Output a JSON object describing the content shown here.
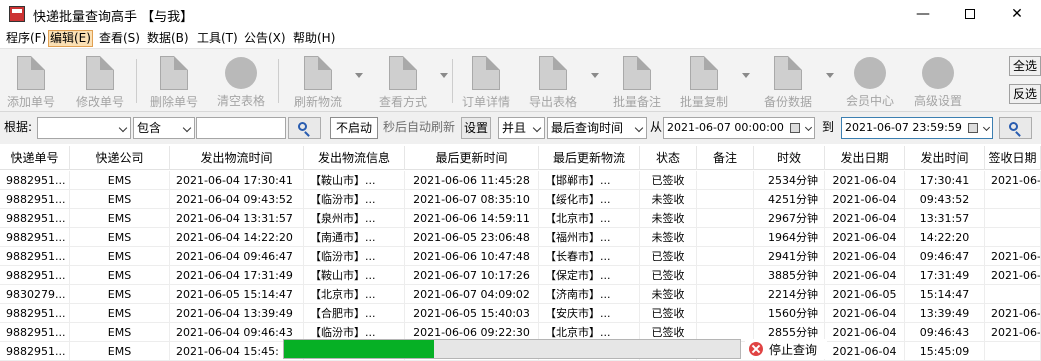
{
  "window": {
    "title": "快递批量查询高手 【与我】",
    "minimize": "—",
    "close": "✕"
  },
  "menu": [
    "程序(F)",
    "编辑(E)",
    "查看(S)",
    "数据(B)",
    "工具(T)",
    "公告(X)",
    "帮助(H)"
  ],
  "toolbar": {
    "add": "添加单号",
    "edit": "修改单号",
    "delete": "删除单号",
    "clear": "清空表格",
    "refresh": "刷新物流",
    "view_mode": "查看方式",
    "details": "订单详情",
    "export": "导出表格",
    "batch_note": "批量备注",
    "batch_copy": "批量复制",
    "backup": "备份数据",
    "member": "会员中心",
    "advanced": "高级设置",
    "select_all": "全选",
    "invert": "反选"
  },
  "filter": {
    "by_label": "根据:",
    "by_value": "",
    "match_value": "包含",
    "keyword": "",
    "auto_button": "不启动",
    "auto_label": "秒后自动刷新",
    "settings_button": "设置",
    "logic_value": "并且",
    "time_field_value": "最后查询时间",
    "from_label": "从",
    "from_value": "2021-06-07 00:00:00",
    "to_label": "到",
    "to_value": "2021-06-07 23:59:59"
  },
  "table": {
    "columns": [
      "快递单号",
      "快递公司",
      "发出物流时间",
      "发出物流信息",
      "最后更新时间",
      "最后更新物流",
      "状态",
      "备注",
      "时效",
      "发出日期",
      "发出时间",
      "签收日期"
    ],
    "rows": [
      [
        "9882951...",
        "EMS",
        "2021-06-04 17:30:41",
        "【鞍山市】...",
        "2021-06-06 11:45:28",
        "【邯郸市】...",
        "已签收",
        "",
        "2534分钟",
        "2021-06-04",
        "17:30:41",
        "2021-06-"
      ],
      [
        "9882951...",
        "EMS",
        "2021-06-04 09:43:52",
        "【临汾市】...",
        "2021-06-07 08:35:10",
        "【绥化市】...",
        "未签收",
        "",
        "4251分钟",
        "2021-06-04",
        "09:43:52",
        ""
      ],
      [
        "9882951...",
        "EMS",
        "2021-06-04 13:31:57",
        "【泉州市】...",
        "2021-06-06 14:59:11",
        "【北京市】...",
        "未签收",
        "",
        "2967分钟",
        "2021-06-04",
        "13:31:57",
        ""
      ],
      [
        "9882951...",
        "EMS",
        "2021-06-04 14:22:20",
        "【南通市】...",
        "2021-06-05 23:06:48",
        "【福州市】...",
        "未签收",
        "",
        "1964分钟",
        "2021-06-04",
        "14:22:20",
        ""
      ],
      [
        "9882951...",
        "EMS",
        "2021-06-04 09:46:47",
        "【临汾市】...",
        "2021-06-06 10:47:48",
        "【长春市】...",
        "已签收",
        "",
        "2941分钟",
        "2021-06-04",
        "09:46:47",
        "2021-06-"
      ],
      [
        "9882951...",
        "EMS",
        "2021-06-04 17:31:49",
        "【鞍山市】...",
        "2021-06-07 10:17:26",
        "【保定市】...",
        "已签收",
        "",
        "3885分钟",
        "2021-06-04",
        "17:31:49",
        "2021-06-"
      ],
      [
        "9830279...",
        "EMS",
        "2021-06-05 15:14:47",
        "【北京市】...",
        "2021-06-07 04:09:02",
        "【济南市】...",
        "未签收",
        "",
        "2214分钟",
        "2021-06-05",
        "15:14:47",
        ""
      ],
      [
        "9882951...",
        "EMS",
        "2021-06-04 13:39:49",
        "【合肥市】...",
        "2021-06-05 15:40:03",
        "【安庆市】...",
        "已签收",
        "",
        "1560分钟",
        "2021-06-04",
        "13:39:49",
        "2021-06-"
      ],
      [
        "9882951...",
        "EMS",
        "2021-06-04 09:46:43",
        "【临汾市】...",
        "2021-06-06 09:22:30",
        "【北京市】...",
        "已签收",
        "",
        "2855分钟",
        "2021-06-04",
        "09:46:43",
        "2021-06-"
      ],
      [
        "9882951...",
        "EMS",
        "2021-06-04 15:45:",
        "",
        "",
        "",
        "",
        "",
        "",
        "2021-06-04",
        "15:45:09",
        ""
      ]
    ]
  },
  "progress": {
    "fraction": 0.33,
    "stop_label": "停止查询"
  }
}
